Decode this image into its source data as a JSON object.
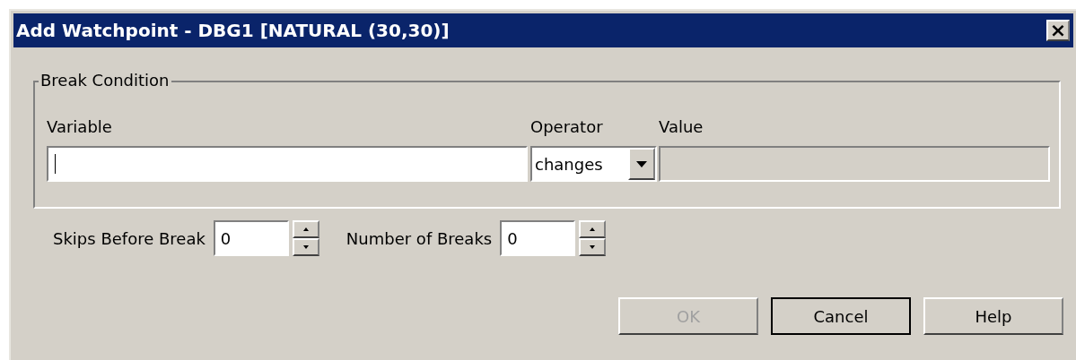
{
  "window": {
    "title": "Add Watchpoint - DBG1 [NATURAL (30,30)]",
    "close": "×"
  },
  "break_condition": {
    "title": "Break Condition",
    "variable": {
      "label": "Variable",
      "focused": true
    },
    "operator": {
      "label": "Operator",
      "value": "changes"
    },
    "value": {
      "label": "Value",
      "disabled": true
    }
  },
  "spinners": [
    {
      "label": "Skips Before Break",
      "value": "0"
    },
    {
      "label": "Number of Breaks",
      "value": "0"
    }
  ],
  "buttons": [
    {
      "label": "OK",
      "disabled": true,
      "default": false
    },
    {
      "label": "Cancel",
      "disabled": false,
      "default": true
    },
    {
      "label": "Help",
      "disabled": false,
      "default": false
    }
  ]
}
